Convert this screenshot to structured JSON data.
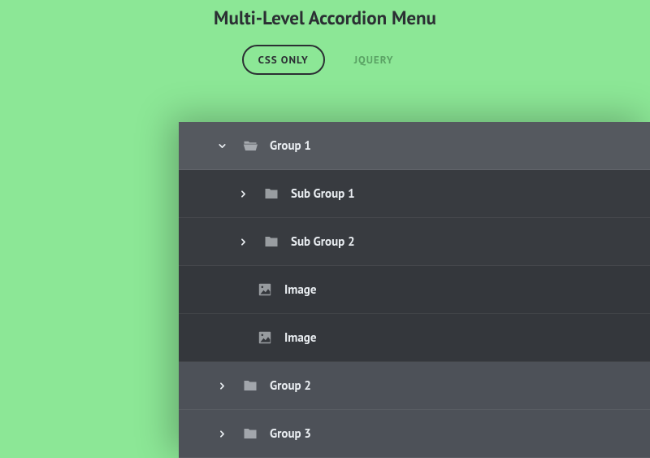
{
  "title": "Multi-Level Accordion Menu",
  "tabs": {
    "cssonly": "CSS ONLY",
    "jquery": "JQUERY"
  },
  "menu": {
    "group1": {
      "label": "Group 1"
    },
    "subgroup1": {
      "label": "Sub Group 1"
    },
    "subgroup2": {
      "label": "Sub Group 2"
    },
    "image1": {
      "label": "Image"
    },
    "image2": {
      "label": "Image"
    },
    "group2": {
      "label": "Group 2"
    },
    "group3": {
      "label": "Group 3"
    }
  },
  "colors": {
    "background": "#8ce796",
    "heading": "#2b2f33",
    "accordionDark": "#383b40",
    "accordionMid": "#4d5158",
    "text": "#e9edf1"
  }
}
